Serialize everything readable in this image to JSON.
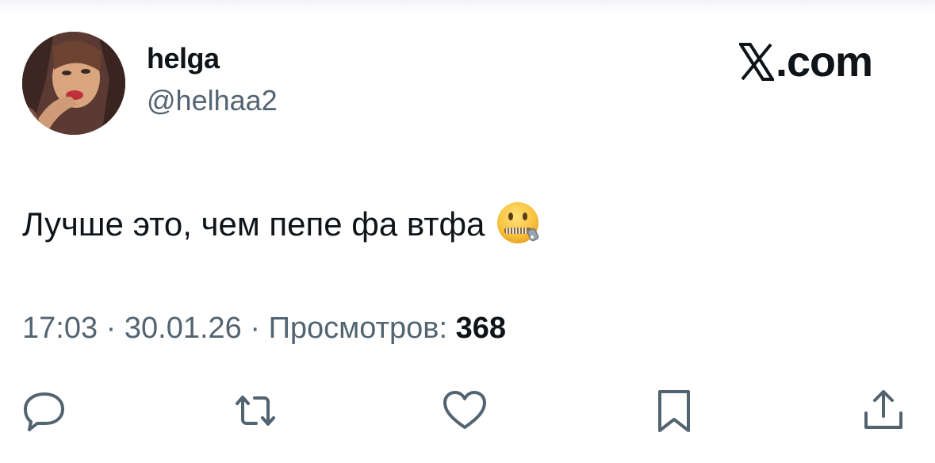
{
  "user": {
    "display_name": "helga",
    "handle": "@helhaa2"
  },
  "brand": {
    "logo_letter": "X",
    "suffix": ".com"
  },
  "tweet": {
    "text": "Лучше это, чем пепе фа втфа",
    "emoji": "zipper-mouth-face"
  },
  "meta": {
    "time": "17:03",
    "separator": " · ",
    "date": "30.01.26",
    "views_label": "Просмотров: ",
    "views_count": "368"
  },
  "actions": {
    "icons": [
      "reply-icon",
      "retweet-icon",
      "like-icon",
      "bookmark-icon",
      "share-icon"
    ],
    "icon_color": "#536471"
  },
  "colors": {
    "text": "#0f1419",
    "secondary": "#536471",
    "emoji_face": "#f7c23c"
  }
}
